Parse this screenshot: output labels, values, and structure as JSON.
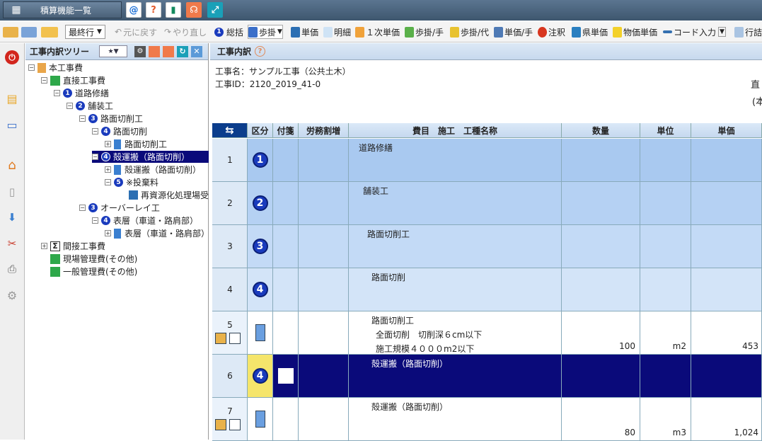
{
  "topbar": {
    "menu_label": "積算機能一覧"
  },
  "toolbar": {
    "dropdown": "最終行",
    "undo": "元に戻す",
    "redo": "やり直し",
    "items": [
      "総括",
      "歩掛",
      "単価",
      "明細",
      "１次単価",
      "歩掛/手",
      "歩掛/代",
      "単価/手",
      "注釈",
      "県単価",
      "物価単価",
      "コード入力",
      "行詰"
    ]
  },
  "tree": {
    "title": "工事内訳ツリー",
    "nodes": [
      {
        "label": "本工事費",
        "num": ""
      },
      {
        "label": "直接工事費",
        "num": ""
      },
      {
        "label": "道路修繕",
        "num": "1"
      },
      {
        "label": "舗装工",
        "num": "2"
      },
      {
        "label": "路面切削工",
        "num": "3"
      },
      {
        "label": "路面切削",
        "num": "4"
      },
      {
        "label": "路面切削工",
        "num": ""
      },
      {
        "label": "殻運搬（路面切削）",
        "num": "4"
      },
      {
        "label": "殻運搬（路面切削）",
        "num": ""
      },
      {
        "label": "※投棄料",
        "num": "5"
      },
      {
        "label": "再資源化処理場受",
        "num": ""
      },
      {
        "label": "オーバーレイ工",
        "num": "3"
      },
      {
        "label": "表層（車道・路肩部）",
        "num": "4"
      },
      {
        "label": "表層（車道・路肩部）",
        "num": ""
      },
      {
        "label": "間接工事費",
        "num": ""
      },
      {
        "label": "現場管理費(その他)",
        "num": ""
      },
      {
        "label": "一般管理費(その他)",
        "num": ""
      }
    ]
  },
  "main": {
    "title": "工事内訳",
    "project_name": "工事名：サンプル工事（公共土木）",
    "project_id": "工事ID：2120_2019_41-0",
    "right_text1": "直",
    "right_text2": "(本",
    "headers": [
      "区分",
      "付箋",
      "労務割増",
      "費目　施工　工種名称",
      "数量",
      "単位",
      "単価"
    ],
    "rows": [
      {
        "no": "1",
        "num": "1",
        "lines": [
          "道路修繕"
        ],
        "qty": "",
        "unit": "",
        "price": ""
      },
      {
        "no": "2",
        "num": "2",
        "lines": [
          "舗装工"
        ],
        "qty": "",
        "unit": "",
        "price": ""
      },
      {
        "no": "3",
        "num": "3",
        "lines": [
          "路面切削工"
        ],
        "qty": "",
        "unit": "",
        "price": ""
      },
      {
        "no": "4",
        "num": "4",
        "lines": [
          "路面切削"
        ],
        "qty": "",
        "unit": "",
        "price": ""
      },
      {
        "no": "5",
        "num": "",
        "lines": [
          "路面切削工",
          "全面切削　切削深６cm以下",
          "施工規模４０００m2以下"
        ],
        "qty": "100",
        "unit": "m2",
        "price": "453"
      },
      {
        "no": "6",
        "num": "4",
        "lines": [
          "殻運搬（路面切削）"
        ],
        "qty": "",
        "unit": "",
        "price": ""
      },
      {
        "no": "7",
        "num": "",
        "lines": [
          "殻運搬（路面切削）"
        ],
        "qty": "80",
        "unit": "m3",
        "price": "1,024"
      }
    ]
  }
}
